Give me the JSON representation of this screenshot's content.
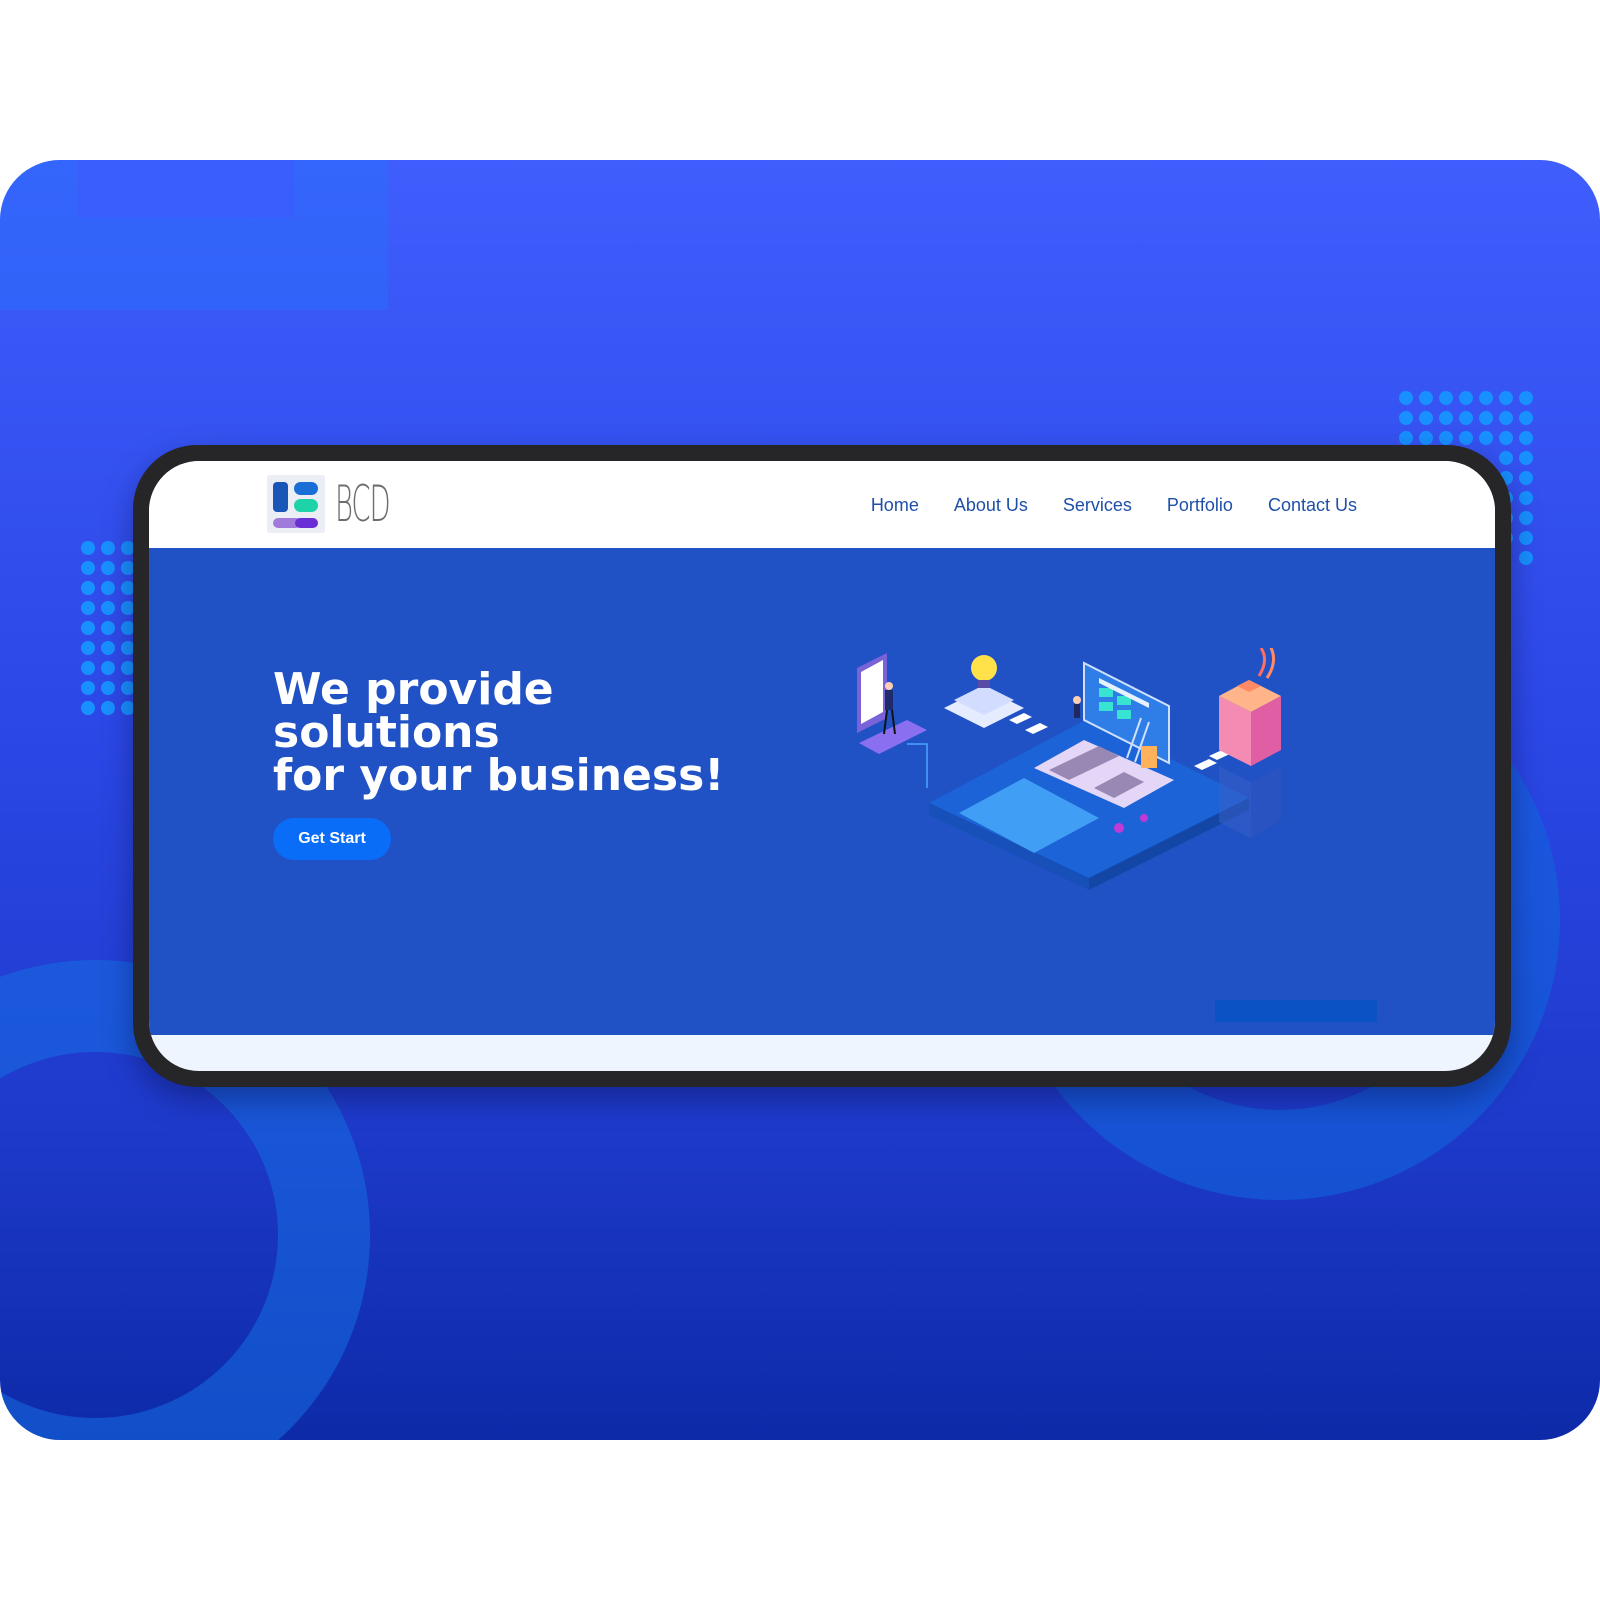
{
  "brand": {
    "logo_text": "BCD"
  },
  "nav": {
    "items": [
      {
        "label": "Home"
      },
      {
        "label": "About Us"
      },
      {
        "label": "Services"
      },
      {
        "label": "Portfolio"
      },
      {
        "label": "Contact Us"
      }
    ]
  },
  "hero": {
    "title_lines": [
      "We provide",
      "solutions",
      "for your business!"
    ],
    "cta_label": "Get Start"
  },
  "colors": {
    "nav_link": "#1f4fa8",
    "hero_bg": "#2052c6",
    "cta_bg": "#0a6df7",
    "backdrop_top": "#3f5efd",
    "backdrop_bottom": "#0d2aa8",
    "device_frame": "#262628"
  }
}
